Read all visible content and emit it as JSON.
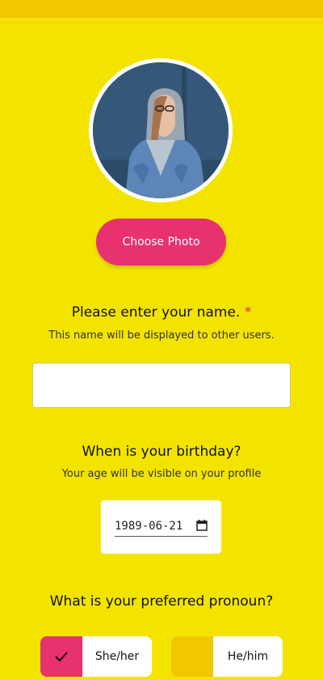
{
  "photo": {
    "button_label": "Choose Photo"
  },
  "name_question": {
    "title": "Please enter your name.",
    "required_mark": "*",
    "subtitle": "This name will be displayed to other users.",
    "value": "",
    "placeholder": ""
  },
  "birthday_question": {
    "title": "When is your birthday?",
    "subtitle": "Your age will be visible on your profile",
    "value": "1989-06-21"
  },
  "pronoun_question": {
    "title": "What is your preferred pronoun?",
    "options": [
      {
        "label": "She/her",
        "selected": true,
        "swatch_color": "#e8316f"
      },
      {
        "label": "He/him",
        "selected": false,
        "swatch_color": "#f2c700"
      }
    ]
  },
  "colors": {
    "background": "#f3e400",
    "accent": "#e8316f",
    "header": "#f2c700"
  }
}
